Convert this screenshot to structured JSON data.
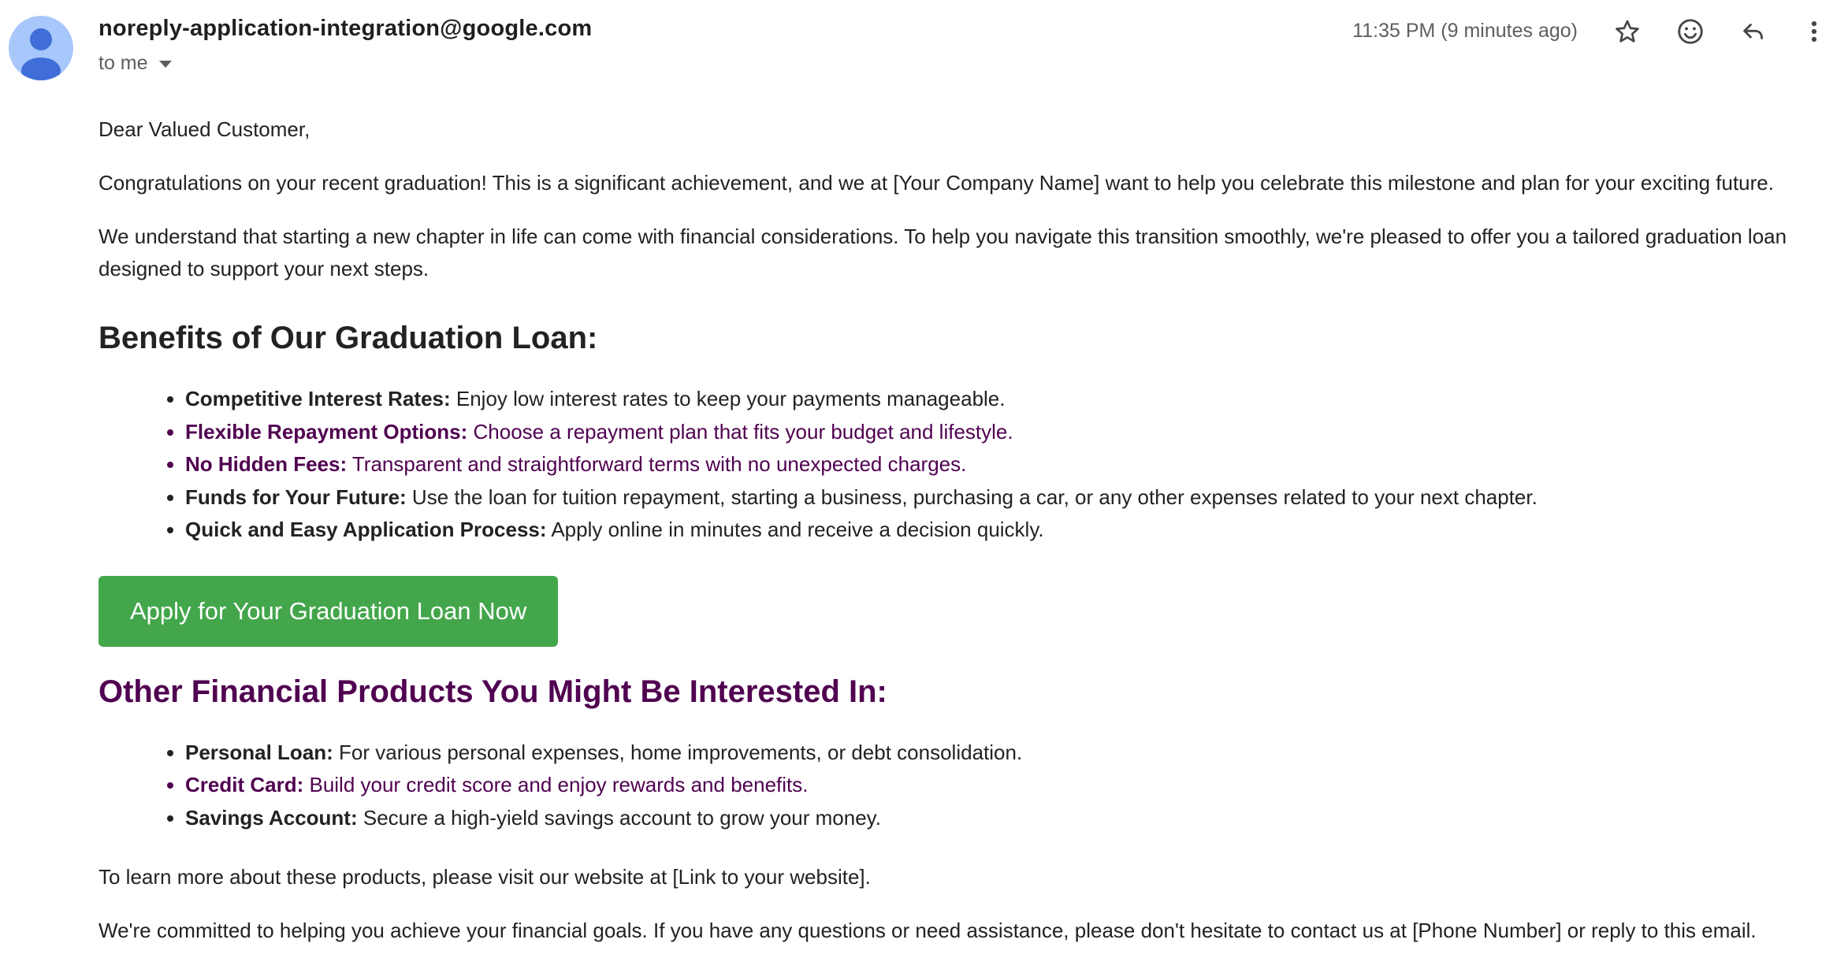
{
  "header": {
    "sender": "noreply-application-integration@google.com",
    "recipient_label": "to me",
    "timestamp": "11:35 PM (9 minutes ago)",
    "icons": [
      "avatar-person-icon",
      "star-icon",
      "emoji-icon",
      "reply-icon",
      "more-vert-icon"
    ]
  },
  "email": {
    "greeting": "Dear Valued Customer,",
    "para1": "Congratulations on your recent graduation! This is a significant achievement, and we at [Your Company Name] want to help you celebrate this milestone and plan for your exciting future.",
    "para2": "We understand that starting a new chapter in life can come with financial considerations. To help you navigate this transition smoothly, we're pleased to offer you a tailored graduation loan designed to support your next steps.",
    "benefits_heading": "Benefits of Our Graduation Loan:",
    "benefits": [
      {
        "title": "Competitive Interest Rates:",
        "text": " Enjoy low interest rates to keep your payments manageable."
      },
      {
        "title": "Flexible Repayment Options:",
        "text": " Choose a repayment plan that fits your budget and lifestyle."
      },
      {
        "title": "No Hidden Fees:",
        "text": " Transparent and straightforward terms with no unexpected charges."
      },
      {
        "title": "Funds for Your Future:",
        "text": " Use the loan for tuition repayment, starting a business, purchasing a car, or any other expenses related to your next chapter."
      },
      {
        "title": "Quick and Easy Application Process:",
        "text": " Apply online in minutes and receive a decision quickly."
      }
    ],
    "cta_label": "Apply for Your Graduation Loan Now",
    "other_heading": "Other Financial Products You Might Be Interested In:",
    "products": [
      {
        "title": "Personal Loan:",
        "text": " For various personal expenses, home improvements, or debt consolidation."
      },
      {
        "title": "Credit Card:",
        "text": " Build your credit score and enjoy rewards and benefits."
      },
      {
        "title": "Savings Account:",
        "text": " Secure a high-yield savings account to grow your money."
      }
    ],
    "para3": "To learn more about these products, please visit our website at [Link to your website].",
    "para4": "We're committed to helping you achieve your financial goals. If you have any questions or need assistance, please don't hesitate to contact us at [Phone Number] or reply to this email."
  },
  "colors": {
    "cta_background": "#43a64b",
    "quoted_purple": "#500050",
    "avatar_background": "#a8c7fa",
    "avatar_figure": "#3f6ed8"
  }
}
